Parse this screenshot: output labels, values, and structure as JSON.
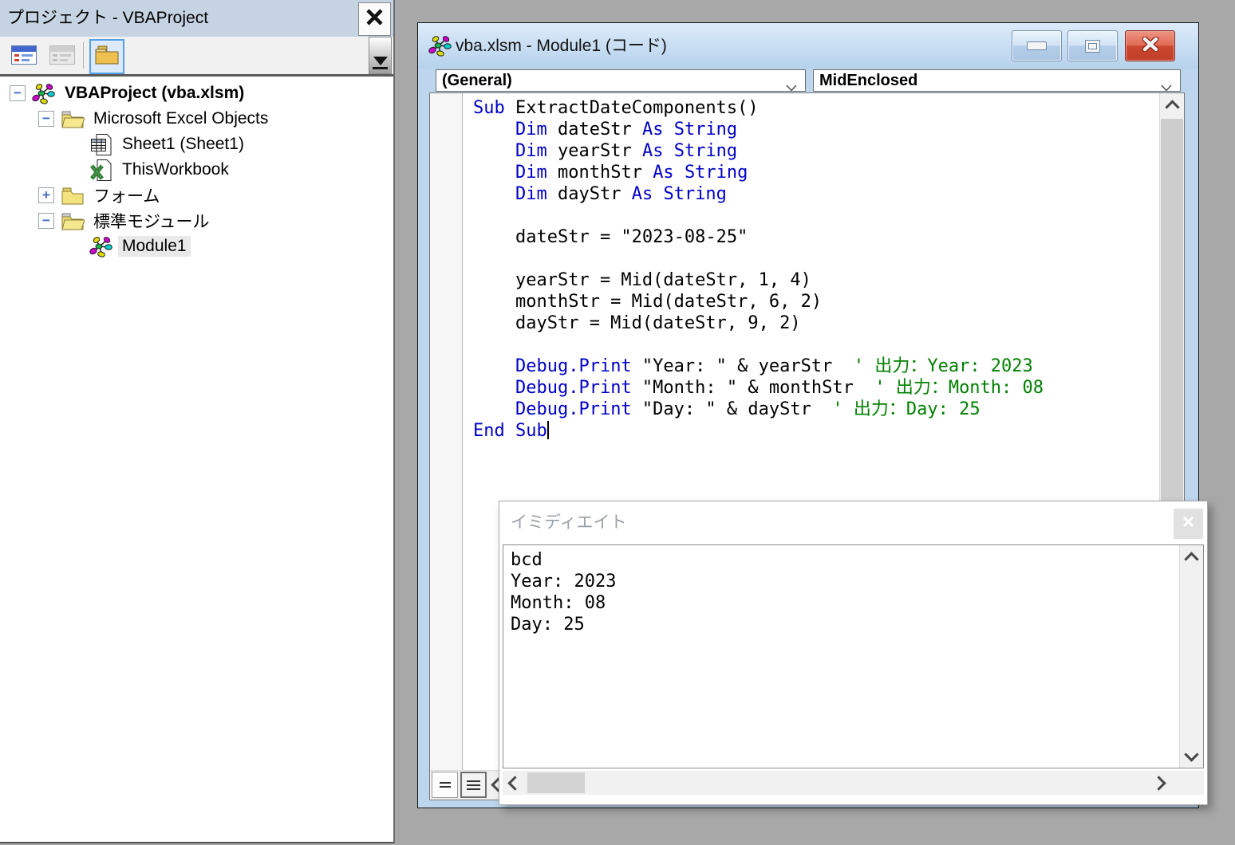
{
  "colors": {
    "keyword_blue": "#0000C8",
    "comment_green": "#008000",
    "code_black": "#000000",
    "desktop_gray": "#a8a8a8",
    "panel_titlebar": "#c6d3e2",
    "window_titlebar": "#c8ddf2",
    "close_button_red": "#c94a33",
    "selection_gray": "#e9e9e9"
  },
  "project_panel": {
    "title": "プロジェクト - VBAProject",
    "toolbar": {
      "icons": [
        "view-code-icon",
        "view-object-icon",
        "toggle-folders-icon"
      ]
    },
    "tree": [
      {
        "label": "VBAProject (vba.xlsm)",
        "icon": "project-icon",
        "level": 0,
        "expander": "minus",
        "bold": true
      },
      {
        "label": "Microsoft Excel Objects",
        "icon": "folder-open-icon",
        "level": 1,
        "expander": "minus"
      },
      {
        "label": "Sheet1 (Sheet1)",
        "icon": "sheet-icon",
        "level": 2
      },
      {
        "label": "ThisWorkbook",
        "icon": "workbook-icon",
        "level": 2
      },
      {
        "label": "フォーム",
        "icon": "folder-closed-icon",
        "level": 1,
        "expander": "plus"
      },
      {
        "label": "標準モジュール",
        "icon": "folder-open-icon",
        "level": 1,
        "expander": "minus"
      },
      {
        "label": "Module1",
        "icon": "module-icon",
        "level": 2,
        "selected": true
      }
    ]
  },
  "code_window": {
    "title": "vba.xlsm - Module1 (コード)",
    "object_box": "(General)",
    "procedure_box": "MidEnclosed",
    "caret_after_line": 15,
    "code_lines": [
      [
        [
          "Sub",
          "k"
        ],
        [
          " ExtractDateComponents()",
          "n"
        ]
      ],
      [
        [
          "    ",
          "n"
        ],
        [
          "Dim",
          "k"
        ],
        [
          " dateStr ",
          "n"
        ],
        [
          "As",
          "k"
        ],
        [
          " ",
          "n"
        ],
        [
          "String",
          "k"
        ]
      ],
      [
        [
          "    ",
          "n"
        ],
        [
          "Dim",
          "k"
        ],
        [
          " yearStr ",
          "n"
        ],
        [
          "As",
          "k"
        ],
        [
          " ",
          "n"
        ],
        [
          "String",
          "k"
        ]
      ],
      [
        [
          "    ",
          "n"
        ],
        [
          "Dim",
          "k"
        ],
        [
          " monthStr ",
          "n"
        ],
        [
          "As",
          "k"
        ],
        [
          " ",
          "n"
        ],
        [
          "String",
          "k"
        ]
      ],
      [
        [
          "    ",
          "n"
        ],
        [
          "Dim",
          "k"
        ],
        [
          " dayStr ",
          "n"
        ],
        [
          "As",
          "k"
        ],
        [
          " ",
          "n"
        ],
        [
          "String",
          "k"
        ]
      ],
      [],
      [
        [
          "    dateStr = \"2023-08-25\"",
          "n"
        ]
      ],
      [],
      [
        [
          "    yearStr = Mid(dateStr, 1, 4)",
          "n"
        ]
      ],
      [
        [
          "    monthStr = Mid(dateStr, 6, 2)",
          "n"
        ]
      ],
      [
        [
          "    dayStr = Mid(dateStr, 9, 2)",
          "n"
        ]
      ],
      [],
      [
        [
          "    ",
          "n"
        ],
        [
          "Debug.Print",
          "k"
        ],
        [
          " \"Year: \" & yearStr  ",
          "n"
        ],
        [
          "' 出力：Year: 2023",
          "c"
        ]
      ],
      [
        [
          "    ",
          "n"
        ],
        [
          "Debug.Print",
          "k"
        ],
        [
          " \"Month: \" & monthStr  ",
          "n"
        ],
        [
          "' 出力：Month: 08",
          "c"
        ]
      ],
      [
        [
          "    ",
          "n"
        ],
        [
          "Debug.Print",
          "k"
        ],
        [
          " \"Day: \" & dayStr  ",
          "n"
        ],
        [
          "' 出力：Day: 25",
          "c"
        ]
      ],
      [
        [
          "End Sub",
          "k"
        ]
      ]
    ]
  },
  "immediate_window": {
    "title": "イミディエイト",
    "lines": [
      "bcd",
      "Year: 2023",
      "Month: 08",
      "Day: 25"
    ]
  }
}
